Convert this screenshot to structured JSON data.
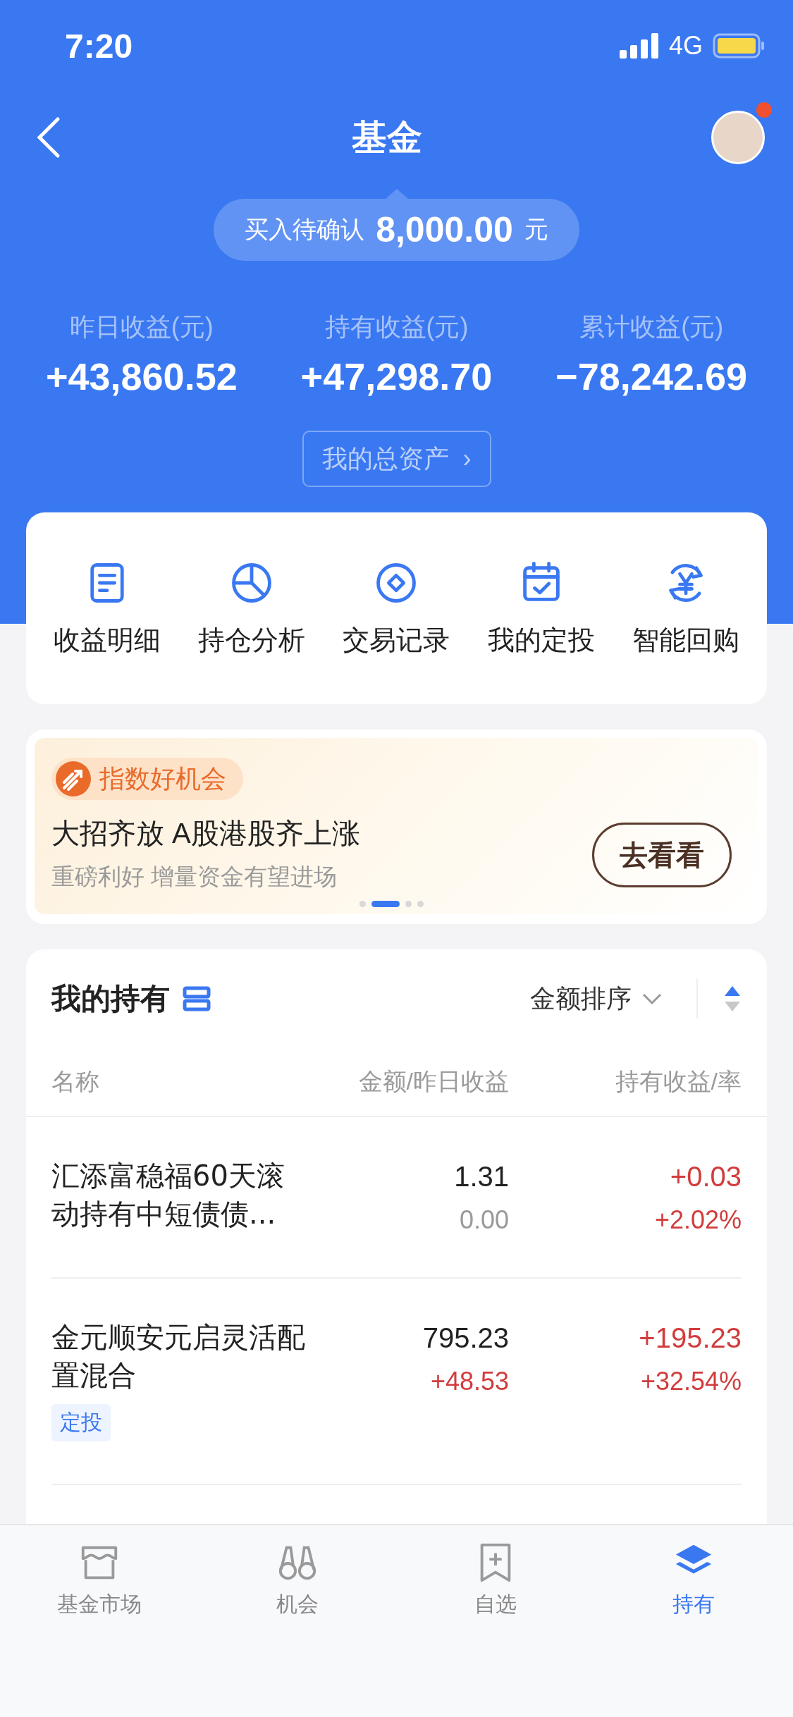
{
  "status_bar": {
    "time": "7:20",
    "network": "4G"
  },
  "nav": {
    "title": "基金",
    "avatar_badge": true
  },
  "pending": {
    "label": "买入待确认",
    "amount": "8,000.00",
    "unit": "元"
  },
  "stats": [
    {
      "label": "昨日收益(元)",
      "value": "+43,860.52"
    },
    {
      "label": "持有收益(元)",
      "value": "+47,298.70"
    },
    {
      "label": "累计收益(元)",
      "value": "−78,242.69"
    }
  ],
  "total_assets_button": {
    "label": "我的总资产",
    "chevron": "›"
  },
  "shortcuts": [
    {
      "label": "收益明细",
      "kind": "doc"
    },
    {
      "label": "持仓分析",
      "kind": "pie"
    },
    {
      "label": "交易记录",
      "kind": "coin"
    },
    {
      "label": "我的定投",
      "kind": "calendar"
    },
    {
      "label": "智能回购",
      "kind": "yuan"
    }
  ],
  "banner": {
    "tag": "指数好机会",
    "title": "大招齐放 A股港股齐上涨",
    "subtitle": "重磅利好 增量资金有望进场",
    "button": "去看看",
    "pages": [
      {
        "selected": false
      },
      {
        "selected": true
      },
      {
        "selected": false
      },
      {
        "selected": false
      }
    ]
  },
  "holdings": {
    "title": "我的持有",
    "sort_label": "金额排序",
    "columns": [
      "名称",
      "金额/昨日收益",
      "持有收益/率"
    ],
    "rows": [
      {
        "name": "汇添富稳福60天滚动持有中短债债...",
        "amount": "1.31",
        "yesterday": {
          "text": "0.00",
          "color": "#9a9a9a"
        },
        "profit": {
          "text": "+0.03",
          "color": "#d23c3c"
        },
        "rate": {
          "text": "+2.02%",
          "color": "#d23c3c"
        }
      },
      {
        "name": "金元顺安元启灵活配置混合",
        "amount": "795.23",
        "yesterday": {
          "text": "+48.53",
          "color": "#d23c3c"
        },
        "profit": {
          "text": "+195.23",
          "color": "#d23c3c"
        },
        "rate": {
          "text": "+32.54%",
          "color": "#d23c3c"
        },
        "tag": "定投"
      }
    ]
  },
  "tabs": [
    {
      "label": "基金市场",
      "kind": "store",
      "selected": false
    },
    {
      "label": "机会",
      "kind": "binoculars",
      "selected": false
    },
    {
      "label": "自选",
      "kind": "bookmark",
      "selected": false
    },
    {
      "label": "持有",
      "kind": "layers",
      "selected": true
    }
  ]
}
